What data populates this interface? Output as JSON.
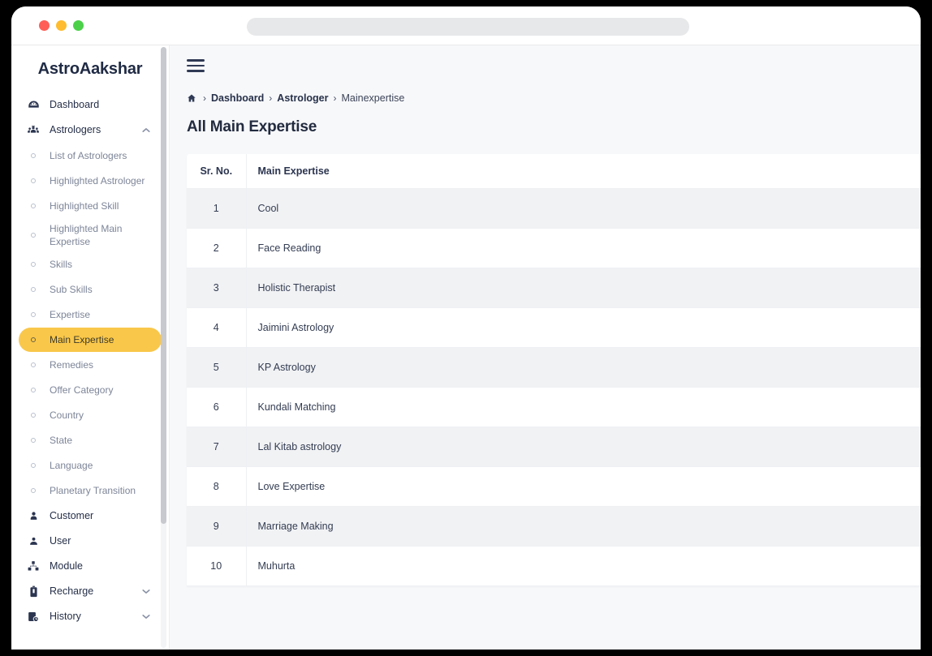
{
  "browser": {
    "traffic_lights": [
      "close-red",
      "minimize-yellow",
      "maximize-green"
    ],
    "url_value": "",
    "url_placeholder": ""
  },
  "sidebar": {
    "brand": "AstroAakshar",
    "items": [
      {
        "label": "Dashboard",
        "icon": "dashboard-gauge-icon",
        "type": "link"
      },
      {
        "label": "Astrologers",
        "icon": "people-group-icon",
        "type": "parent",
        "chevron": "chevron-up-icon",
        "expanded": true
      }
    ],
    "sub_items": [
      {
        "label": "List of Astrologers",
        "active": false
      },
      {
        "label": "Highlighted Astrologer",
        "active": false
      },
      {
        "label": "Highlighted Skill",
        "active": false
      },
      {
        "label": "Highlighted Main Expertise",
        "active": false
      },
      {
        "label": "Skills",
        "active": false
      },
      {
        "label": "Sub Skills",
        "active": false
      },
      {
        "label": "Expertise",
        "active": false
      },
      {
        "label": "Main Expertise",
        "active": true
      },
      {
        "label": "Remedies",
        "active": false
      },
      {
        "label": "Offer Category",
        "active": false
      },
      {
        "label": "Country",
        "active": false
      },
      {
        "label": "State",
        "active": false
      },
      {
        "label": "Language",
        "active": false
      },
      {
        "label": "Planetary Transition",
        "active": false
      }
    ],
    "bottom_items": [
      {
        "label": "Customer",
        "icon": "user-person-icon",
        "chevron": null
      },
      {
        "label": "User",
        "icon": "user-solid-icon",
        "chevron": null
      },
      {
        "label": "Module",
        "icon": "module-blocks-icon",
        "chevron": null
      },
      {
        "label": "Recharge",
        "icon": "recharge-battery-icon",
        "chevron": "chevron-down-icon"
      },
      {
        "label": "History",
        "icon": "history-clock-icon",
        "chevron": "chevron-down-icon"
      }
    ]
  },
  "topbar": {
    "menu_toggle": "hamburger-menu-icon"
  },
  "breadcrumb": {
    "home_icon": "home-icon",
    "separator": "›",
    "items": [
      {
        "label": "Dashboard",
        "is_link": true
      },
      {
        "label": "Astrologer",
        "is_link": true
      },
      {
        "label": "Mainexpertise",
        "is_link": false
      }
    ]
  },
  "page": {
    "title": "All Main Expertise"
  },
  "table": {
    "columns": [
      "Sr. No.",
      "Main Expertise"
    ],
    "rows": [
      {
        "sr": "1",
        "name": "Cool"
      },
      {
        "sr": "2",
        "name": "Face Reading"
      },
      {
        "sr": "3",
        "name": "Holistic Therapist"
      },
      {
        "sr": "4",
        "name": "Jaimini Astrology"
      },
      {
        "sr": "5",
        "name": "KP Astrology"
      },
      {
        "sr": "6",
        "name": "Kundali Matching"
      },
      {
        "sr": "7",
        "name": "Lal Kitab astrology"
      },
      {
        "sr": "8",
        "name": "Love Expertise"
      },
      {
        "sr": "9",
        "name": "Marriage Making"
      },
      {
        "sr": "10",
        "name": "Muhurta"
      }
    ]
  },
  "colors": {
    "accent_active": "#f9c74a",
    "page_background": "#f7f8fa",
    "sidebar_background": "#ffffff",
    "text_dark": "#252f48",
    "text_muted": "#7d8598",
    "row_stripe": "#f1f2f4"
  }
}
